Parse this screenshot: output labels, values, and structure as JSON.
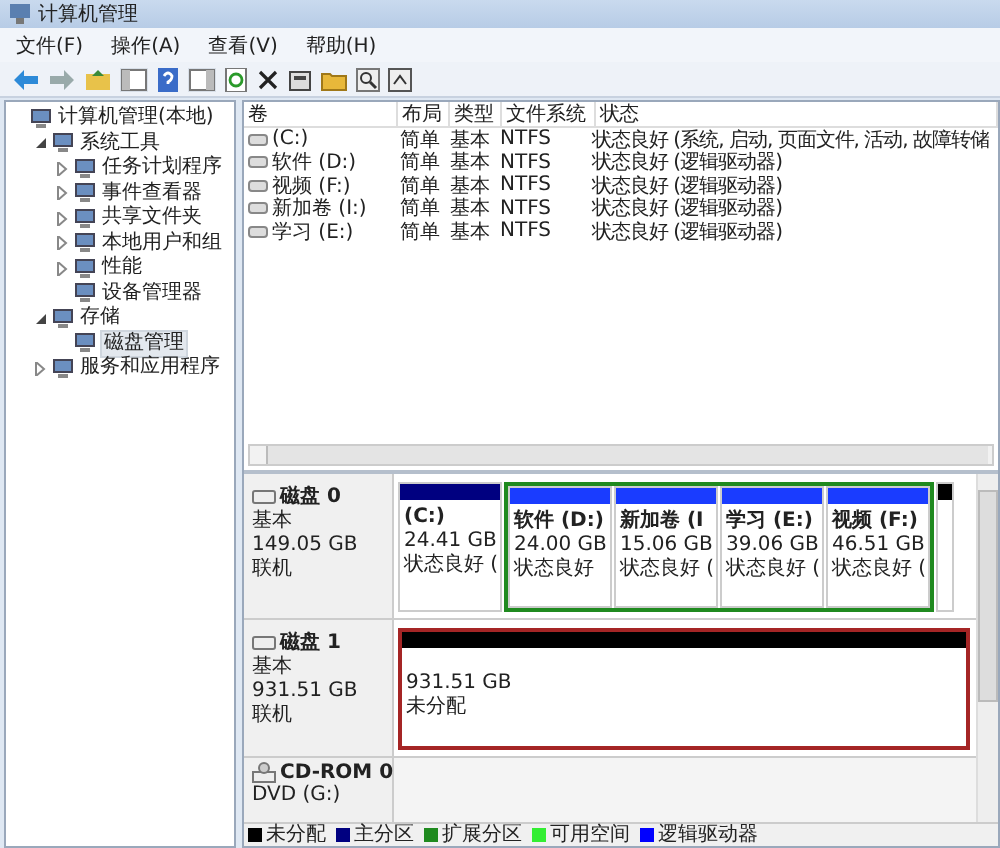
{
  "window": {
    "title": "计算机管理"
  },
  "menu": [
    "文件(F)",
    "操作(A)",
    "查看(V)",
    "帮助(H)"
  ],
  "tree": [
    {
      "label": "计算机管理(本地)",
      "selected": false,
      "children": [
        {
          "label": "系统工具",
          "expanded": true,
          "selected": false,
          "children": [
            {
              "label": "任务计划程序",
              "expanded": false,
              "selected": false
            },
            {
              "label": "事件查看器",
              "expanded": false,
              "selected": false
            },
            {
              "label": "共享文件夹",
              "expanded": false,
              "selected": false
            },
            {
              "label": "本地用户和组",
              "expanded": false,
              "selected": false
            },
            {
              "label": "性能",
              "expanded": false,
              "selected": false
            },
            {
              "label": "设备管理器",
              "selected": false
            }
          ]
        },
        {
          "label": "存储",
          "expanded": true,
          "selected": false,
          "children": [
            {
              "label": "磁盘管理",
              "selected": true
            }
          ]
        },
        {
          "label": "服务和应用程序",
          "expanded": false,
          "selected": false
        }
      ]
    }
  ],
  "volumes": {
    "columns": [
      "卷",
      "布局",
      "类型",
      "文件系统",
      "状态"
    ],
    "rows": [
      [
        "(C:)",
        "简单",
        "基本",
        "NTFS",
        "状态良好 (系统, 启动, 页面文件, 活动, 故障转储"
      ],
      [
        "软件 (D:)",
        "简单",
        "基本",
        "NTFS",
        "状态良好 (逻辑驱动器)"
      ],
      [
        "视频 (F:)",
        "简单",
        "基本",
        "NTFS",
        "状态良好 (逻辑驱动器)"
      ],
      [
        "新加卷 (I:)",
        "简单",
        "基本",
        "NTFS",
        "状态良好 (逻辑驱动器)"
      ],
      [
        "学习 (E:)",
        "简单",
        "基本",
        "NTFS",
        "状态良好 (逻辑驱动器)"
      ]
    ]
  },
  "disks": [
    {
      "kind": "disk",
      "name": "磁盘 0",
      "type": "基本",
      "size": "149.05 GB",
      "status": "联机",
      "partitions": [
        {
          "kind": "primary",
          "label": "(C:)",
          "size": "24.41 GB",
          "status": "状态良好 (",
          "selected": false
        },
        {
          "kind": "extended",
          "children": [
            {
              "kind": "logical",
              "label": "软件 (D:)",
              "size": "24.00 GB",
              "status": "状态良好",
              "selected": false
            },
            {
              "kind": "logical",
              "label": "新加卷 (I",
              "size": "15.06 GB",
              "status": "状态良好 (",
              "selected": false
            },
            {
              "kind": "logical",
              "label": "学习 (E:)",
              "size": "39.06 GB",
              "status": "状态良好 (",
              "selected": false
            },
            {
              "kind": "logical",
              "label": "视频 (F:)",
              "size": "46.51 GB",
              "status": "状态良好 (",
              "selected": false
            }
          ]
        },
        {
          "kind": "unallocated",
          "selected": false
        }
      ]
    },
    {
      "kind": "disk",
      "name": "磁盘 1",
      "type": "基本",
      "size": "931.51 GB",
      "status": "联机",
      "partitions": [
        {
          "kind": "unallocated",
          "size": "931.51 GB",
          "status": "未分配",
          "selected": true
        }
      ]
    },
    {
      "kind": "cdrom",
      "name": "CD-ROM 0",
      "type": "DVD (G:)"
    }
  ],
  "legend": [
    {
      "label": "未分配",
      "color": "#000000"
    },
    {
      "label": "主分区",
      "color": "#000080"
    },
    {
      "label": "扩展分区",
      "color": "#1f8a1f"
    },
    {
      "label": "可用空间",
      "color": "#33ee33"
    },
    {
      "label": "逻辑驱动器",
      "color": "#0000ff"
    }
  ]
}
